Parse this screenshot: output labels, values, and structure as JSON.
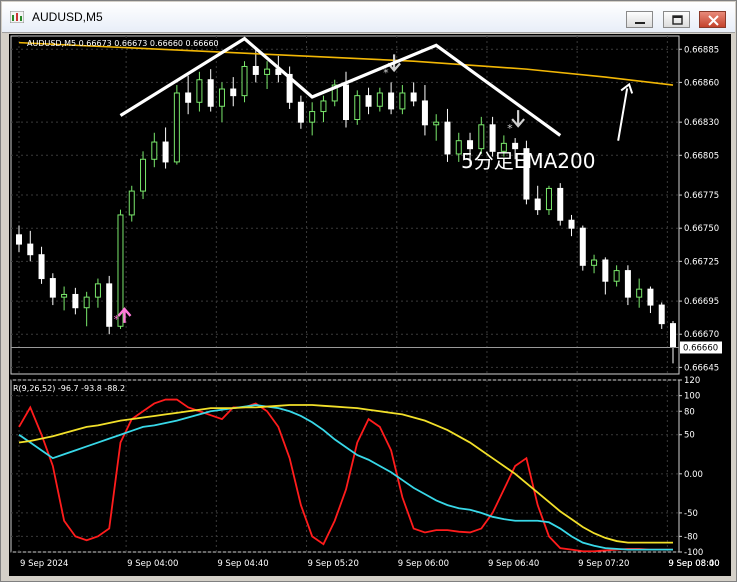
{
  "window": {
    "title": "AUDUSD,M5"
  },
  "chart_header": "AUDUSD,M5  0.66673 0.66673 0.66660 0.66660",
  "annotation_text": "5分足EMA200",
  "current_price_label": "0.66660",
  "colors": {
    "background": "#000000",
    "grid": "#3a3a3a",
    "axis_text": "#ffffff",
    "bull_candle": "#7ae86c",
    "bear_candle": "#ffffff",
    "ema": "#f2b705",
    "osc_red": "#ff1c1c",
    "osc_cyan": "#38d8e8",
    "osc_yellow": "#f2e02a",
    "buy_arrow": "#ff7ad9",
    "sell_arrow": "#cfcfcf",
    "annotation": "#ffffff"
  },
  "chart_data": [
    {
      "type": "candlestick",
      "symbol": "AUDUSD",
      "timeframe": "M5",
      "ylim": [
        0.6664,
        0.66895
      ],
      "y_ticks": [
        "0.66885",
        "0.66860",
        "0.66830",
        "0.66805",
        "0.66775",
        "0.66750",
        "0.66725",
        "0.66695",
        "0.66670",
        "0.66645"
      ],
      "x_ticks": [
        "9 Sep 2024",
        "9 Sep 04:00",
        "9 Sep 04:40",
        "9 Sep 05:20",
        "9 Sep 06:00",
        "9 Sep 06:40",
        "9 Sep 07:20",
        "9 Sep 08:00",
        "9 Sep 08:40"
      ],
      "ema_label": "EMA200",
      "ohlc": [
        [
          0.66745,
          0.66752,
          0.66732,
          0.66738
        ],
        [
          0.66738,
          0.66748,
          0.66725,
          0.6673
        ],
        [
          0.6673,
          0.66736,
          0.66708,
          0.66712
        ],
        [
          0.66712,
          0.66716,
          0.66692,
          0.66698
        ],
        [
          0.66698,
          0.66706,
          0.66688,
          0.667
        ],
        [
          0.667,
          0.66705,
          0.66685,
          0.6669
        ],
        [
          0.6669,
          0.66702,
          0.66676,
          0.66698
        ],
        [
          0.66698,
          0.66712,
          0.6669,
          0.66708
        ],
        [
          0.66708,
          0.66714,
          0.6667,
          0.66676
        ],
        [
          0.66676,
          0.66764,
          0.66674,
          0.6676
        ],
        [
          0.6676,
          0.66782,
          0.66755,
          0.66778
        ],
        [
          0.66778,
          0.66808,
          0.66772,
          0.66802
        ],
        [
          0.66802,
          0.66822,
          0.66796,
          0.66815
        ],
        [
          0.66815,
          0.66826,
          0.66795,
          0.668
        ],
        [
          0.668,
          0.66858,
          0.66798,
          0.66852
        ],
        [
          0.66852,
          0.66865,
          0.66836,
          0.66845
        ],
        [
          0.66845,
          0.66868,
          0.66838,
          0.66862
        ],
        [
          0.66862,
          0.6687,
          0.66838,
          0.66842
        ],
        [
          0.66842,
          0.6686,
          0.6683,
          0.66855
        ],
        [
          0.66855,
          0.66864,
          0.66842,
          0.6685
        ],
        [
          0.6685,
          0.66876,
          0.66845,
          0.66872
        ],
        [
          0.66872,
          0.66886,
          0.6686,
          0.66866
        ],
        [
          0.66866,
          0.66876,
          0.66855,
          0.6687
        ],
        [
          0.6687,
          0.6688,
          0.6686,
          0.66866
        ],
        [
          0.66866,
          0.66872,
          0.6684,
          0.66845
        ],
        [
          0.66845,
          0.6685,
          0.66825,
          0.6683
        ],
        [
          0.6683,
          0.66845,
          0.6682,
          0.66838
        ],
        [
          0.66838,
          0.6685,
          0.6683,
          0.66846
        ],
        [
          0.66846,
          0.66862,
          0.66842,
          0.66858
        ],
        [
          0.66858,
          0.66868,
          0.66826,
          0.66832
        ],
        [
          0.66832,
          0.66854,
          0.66828,
          0.6685
        ],
        [
          0.6685,
          0.66856,
          0.66836,
          0.66842
        ],
        [
          0.66842,
          0.66856,
          0.66838,
          0.66852
        ],
        [
          0.66852,
          0.6686,
          0.66836,
          0.6684
        ],
        [
          0.6684,
          0.66858,
          0.66836,
          0.66852
        ],
        [
          0.66852,
          0.6686,
          0.66842,
          0.66846
        ],
        [
          0.66846,
          0.66858,
          0.6682,
          0.66828
        ],
        [
          0.66828,
          0.66836,
          0.66816,
          0.6683
        ],
        [
          0.6683,
          0.6684,
          0.668,
          0.66806
        ],
        [
          0.66806,
          0.66822,
          0.668,
          0.66816
        ],
        [
          0.66816,
          0.66822,
          0.66796,
          0.6681
        ],
        [
          0.6681,
          0.66834,
          0.66806,
          0.66828
        ],
        [
          0.66828,
          0.66834,
          0.66804,
          0.66808
        ],
        [
          0.66808,
          0.6682,
          0.66804,
          0.66814
        ],
        [
          0.66814,
          0.66818,
          0.66802,
          0.6681
        ],
        [
          0.6681,
          0.66816,
          0.66768,
          0.66772
        ],
        [
          0.66772,
          0.66782,
          0.6676,
          0.66764
        ],
        [
          0.66764,
          0.66782,
          0.6676,
          0.6678
        ],
        [
          0.6678,
          0.66784,
          0.66752,
          0.66756
        ],
        [
          0.66756,
          0.6676,
          0.66744,
          0.6675
        ],
        [
          0.6675,
          0.66752,
          0.66718,
          0.66722
        ],
        [
          0.66722,
          0.6673,
          0.66716,
          0.66726
        ],
        [
          0.66726,
          0.66728,
          0.667,
          0.6671
        ],
        [
          0.6671,
          0.66722,
          0.66706,
          0.66718
        ],
        [
          0.66718,
          0.66722,
          0.66692,
          0.66698
        ],
        [
          0.66698,
          0.66712,
          0.6669,
          0.66704
        ],
        [
          0.66704,
          0.66706,
          0.66686,
          0.66692
        ],
        [
          0.66692,
          0.66694,
          0.66674,
          0.66678
        ],
        [
          0.66678,
          0.6668,
          0.66648,
          0.6666
        ]
      ],
      "ema200": [
        {
          "x": 0,
          "y": 0.6689
        },
        {
          "x": 20,
          "y": 0.66882
        },
        {
          "x": 35,
          "y": 0.66876
        },
        {
          "x": 45,
          "y": 0.6687
        },
        {
          "x": 52,
          "y": 0.66864
        },
        {
          "x": 58,
          "y": 0.66858
        }
      ],
      "signals": [
        {
          "type": "buy",
          "bar": 9
        },
        {
          "type": "sell",
          "bar": 33
        },
        {
          "type": "sell",
          "bar": 44
        }
      ]
    },
    {
      "type": "line",
      "label": "R(9,26,52) -96.7 -93.8 -88.2",
      "ylim": [
        -100,
        120
      ],
      "y_ticks": [
        "120",
        "100",
        "80",
        "50",
        "0.00",
        "-50",
        "-80",
        "-100"
      ],
      "series": [
        {
          "name": "R9",
          "color": "#ff1c1c",
          "values": [
            60,
            85,
            50,
            10,
            -60,
            -80,
            -85,
            -80,
            -70,
            40,
            70,
            80,
            90,
            95,
            95,
            85,
            80,
            75,
            70,
            85,
            85,
            90,
            80,
            60,
            20,
            -40,
            -80,
            -90,
            -60,
            -20,
            40,
            70,
            60,
            30,
            -30,
            -70,
            -75,
            -72,
            -72,
            -74,
            -75,
            -70,
            -50,
            -20,
            10,
            20,
            -40,
            -80,
            -95,
            -97,
            -99,
            -99,
            -98,
            -97,
            -96,
            -96,
            -97,
            -97,
            -97
          ]
        },
        {
          "name": "R26",
          "color": "#38d8e8",
          "values": [
            50,
            40,
            30,
            20,
            25,
            30,
            35,
            40,
            45,
            50,
            55,
            60,
            62,
            65,
            68,
            72,
            76,
            80,
            82,
            84,
            86,
            88,
            86,
            84,
            80,
            74,
            66,
            56,
            44,
            34,
            24,
            18,
            10,
            2,
            -8,
            -18,
            -26,
            -34,
            -40,
            -44,
            -46,
            -50,
            -55,
            -58,
            -60,
            -60,
            -60,
            -62,
            -70,
            -80,
            -88,
            -92,
            -95,
            -96,
            -97,
            -97,
            -97,
            -97,
            -97
          ]
        },
        {
          "name": "R52",
          "color": "#f2e02a",
          "values": [
            40,
            42,
            45,
            48,
            52,
            56,
            60,
            62,
            65,
            68,
            70,
            72,
            74,
            76,
            78,
            80,
            82,
            84,
            84,
            84,
            85,
            85,
            86,
            87,
            88,
            88,
            88,
            87,
            86,
            85,
            84,
            82,
            80,
            78,
            76,
            72,
            68,
            62,
            56,
            48,
            40,
            30,
            20,
            10,
            0,
            -12,
            -24,
            -36,
            -48,
            -58,
            -68,
            -76,
            -82,
            -86,
            -88,
            -88,
            -88,
            -88,
            -88
          ]
        }
      ]
    }
  ]
}
